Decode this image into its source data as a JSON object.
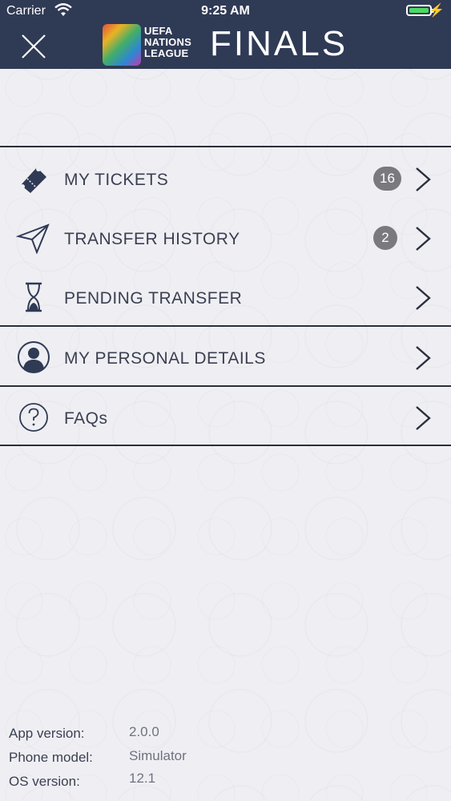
{
  "status_bar": {
    "carrier": "Carrier",
    "time": "9:25 AM",
    "battery_color": "#4cd964"
  },
  "header": {
    "background": "#2f3a55",
    "close_icon": "close-icon",
    "logo_line1": "UEFA",
    "logo_line2": "NATIONS",
    "logo_line3": "LEAGUE",
    "logo_finals": "FINALS"
  },
  "menu": {
    "items": [
      {
        "label": "MY TICKETS",
        "icon": "ticket-icon",
        "badge": "16"
      },
      {
        "label": "TRANSFER HISTORY",
        "icon": "paper-plane-icon",
        "badge": "2"
      },
      {
        "label": "PENDING TRANSFER",
        "icon": "hourglass-icon"
      },
      {
        "label": "MY PERSONAL DETAILS",
        "icon": "user-icon"
      },
      {
        "label": "FAQs",
        "icon": "question-icon"
      }
    ]
  },
  "app_info": {
    "app_version_label": "App version:",
    "app_version_value": "2.0.0",
    "phone_model_label": "Phone model:",
    "phone_model_value": "Simulator",
    "os_version_label": "OS version:",
    "os_version_value": "12.1"
  }
}
